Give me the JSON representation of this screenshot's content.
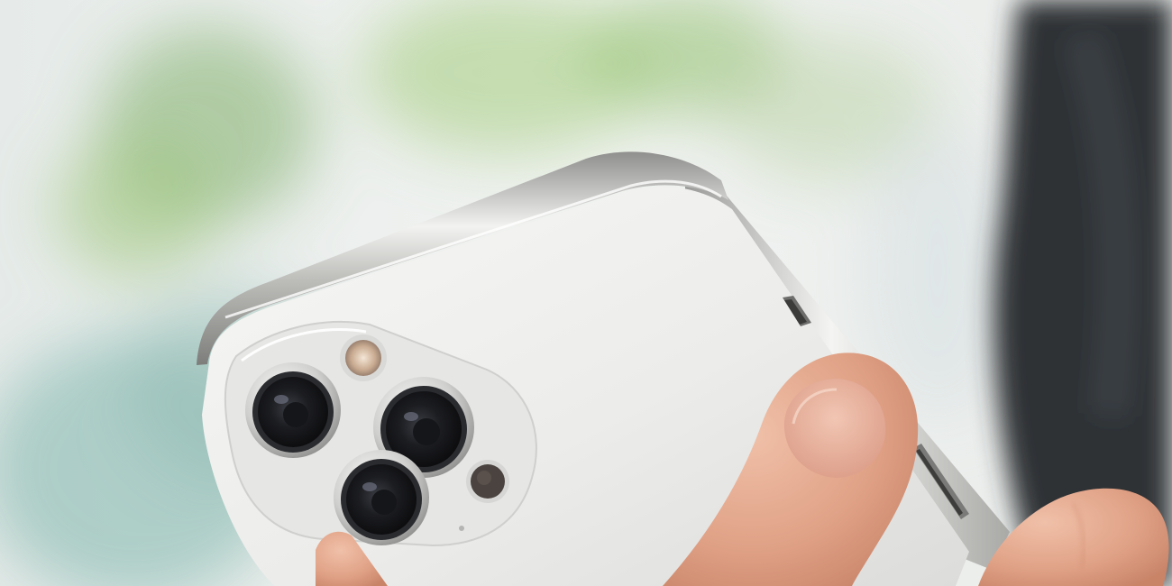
{
  "image": {
    "subject": "white-smartphone-rear-triple-camera-held-in-hand",
    "colors": {
      "background_light": "#eef1ef",
      "foliage_green": "#9cc47a",
      "teal_haze": "#8fb9b1",
      "dark_fabric": "#2f3236",
      "phone_back": "#eeeeec",
      "steel_frame": "#c9c9c6",
      "lens_glass": "#1b1c1f",
      "skin": "#e2a68e"
    }
  }
}
